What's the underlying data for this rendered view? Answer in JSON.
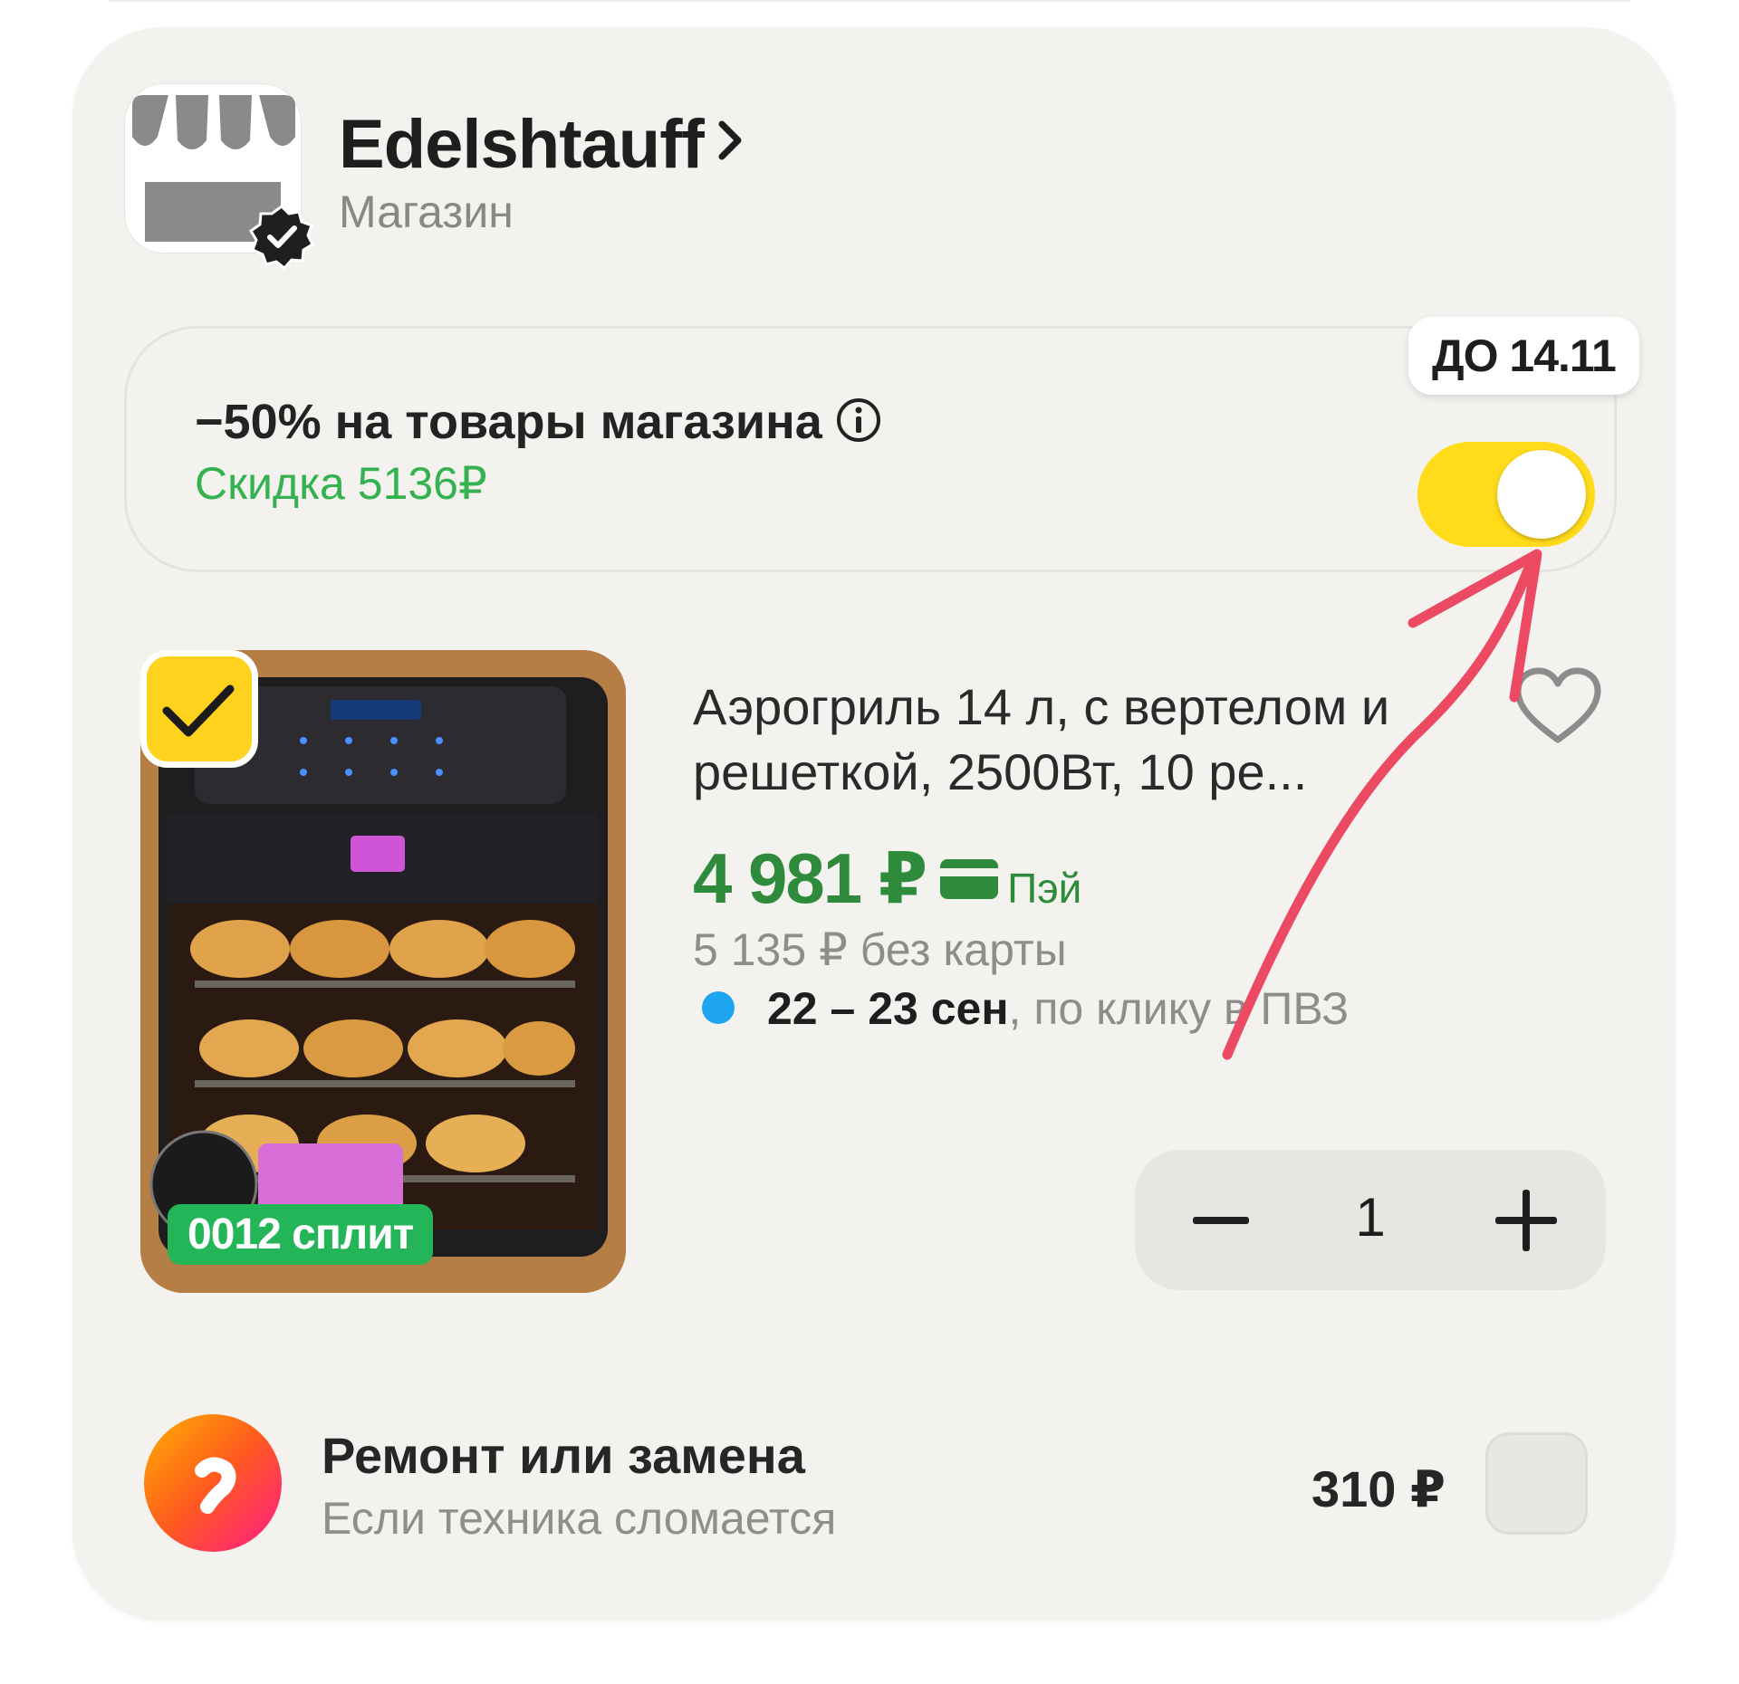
{
  "store": {
    "name": "Edelshtauff",
    "subtitle": "Магазин",
    "logo_icon": "storefront-icon",
    "badge_icon": "verified-check-icon"
  },
  "promo": {
    "deadline_tag": "ДО 14.11",
    "title": "−50% на товары магазина",
    "discount": "Скидка 5136₽",
    "toggle_on": true,
    "accent_color": "#ffdb1a",
    "discount_color": "#33b24f"
  },
  "product": {
    "selected": true,
    "title": "Аэрогриль 14 л, с вертелом и решеткой, 2500Вт, 10 ре...",
    "image_split_badge": "0012 сплит",
    "price": "4 981 ₽",
    "pay_label": "Пэй",
    "price_without_card": "5 135 ₽  без карты",
    "delivery_date": "22 – 23 сен",
    "delivery_method": ", по клику в ПВЗ",
    "quantity": "1",
    "price_color": "#2e8b3c"
  },
  "warranty": {
    "title": "Ремонт или замена",
    "subtitle": "Если техника сломается",
    "price": "310 ₽",
    "checked": false
  }
}
